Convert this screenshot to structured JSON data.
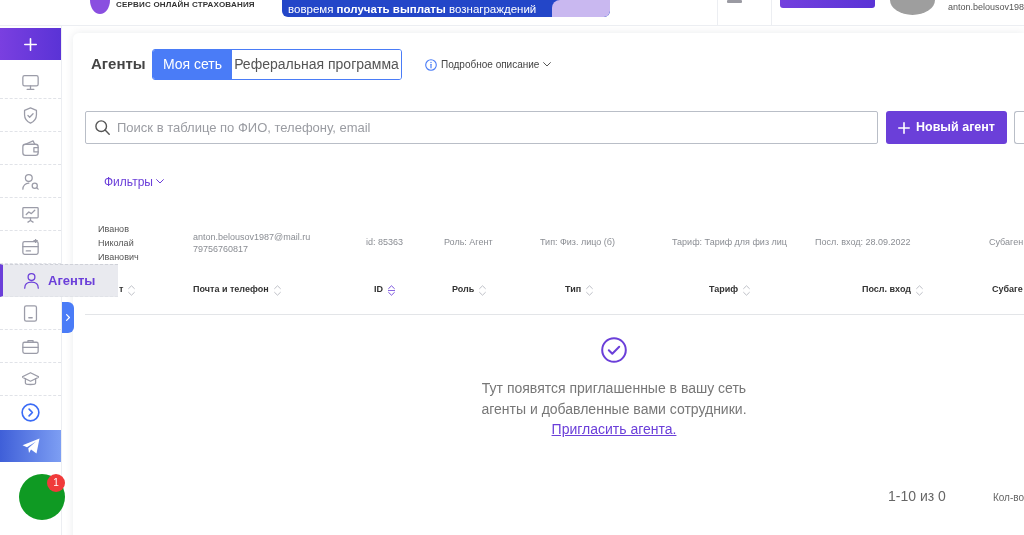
{
  "header": {
    "tagline": "СЕРВИС ОНЛАЙН СТРАХОВАНИЯ",
    "banner_text": "вовремя **получать выплаты** вознаграждений",
    "user_email": "anton.belousov198"
  },
  "sidebar": {
    "items": [
      {
        "selected": false
      },
      {
        "selected": false
      },
      {
        "selected": false
      },
      {
        "selected": false
      },
      {
        "selected": false
      },
      {
        "selected": false
      },
      {
        "label": "Агенты",
        "selected": true
      },
      {
        "selected": false
      },
      {
        "selected": false
      },
      {
        "selected": false
      }
    ]
  },
  "chat_widget": {
    "badge": "1"
  },
  "page": {
    "title": "Агенты",
    "tabs": [
      {
        "label": "Моя сеть",
        "selected": true
      },
      {
        "label": "Реферальная программа",
        "selected": false
      }
    ],
    "details_link": "Подробное описание",
    "search": {
      "placeholder": "Поиск в таблице по ФИО, телефону, email"
    },
    "new_agent_button": "Новый агент",
    "filters_link": "Фильтры"
  },
  "agent_preview": {
    "name": "Иванов Николай Иванович",
    "email": "anton.belousov1987@mail.ru",
    "phone": "79756760817",
    "fields": [
      "id: 85363",
      "Роль: Агент",
      "Тип: Физ. лицо (б)",
      "Тариф: Тариф для физ лиц",
      "Посл. вход: 28.09.2022",
      "Субаген"
    ]
  },
  "table": {
    "columns": [
      {
        "label": "т",
        "sorted": false
      },
      {
        "label": "Почта и телефон",
        "sorted": false
      },
      {
        "label": "ID",
        "sorted": true
      },
      {
        "label": "Роль",
        "sorted": false
      },
      {
        "label": "Тип",
        "sorted": false
      },
      {
        "label": "Тариф",
        "sorted": false
      },
      {
        "label": "Посл. вход",
        "sorted": false
      },
      {
        "label": "Субаге"
      }
    ]
  },
  "empty_state": {
    "message": "Тут появятся приглашенные в вашу сеть агенты и добавленные вами сотрудники.",
    "link": "Пригласить агента."
  },
  "pagination": {
    "range": "1-10 из 0",
    "per_page_label": "Кол-во"
  }
}
